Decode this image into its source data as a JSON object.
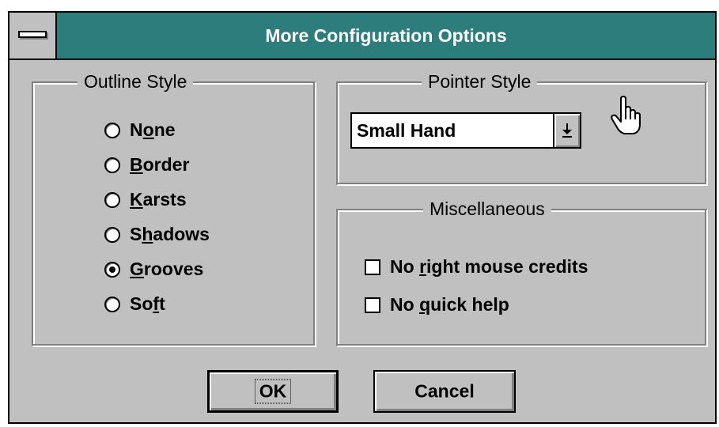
{
  "window": {
    "title": "More Configuration Options"
  },
  "outline_style": {
    "legend": "Outline Style",
    "options": [
      {
        "pre": "N",
        "acc": "o",
        "post": "ne",
        "selected": false
      },
      {
        "pre": "",
        "acc": "B",
        "post": "order",
        "selected": false
      },
      {
        "pre": "",
        "acc": "K",
        "post": "arsts",
        "selected": false
      },
      {
        "pre": "S",
        "acc": "h",
        "post": "adows",
        "selected": false
      },
      {
        "pre": "",
        "acc": "G",
        "post": "rooves",
        "selected": true
      },
      {
        "pre": "So",
        "acc": "f",
        "post": "t",
        "selected": false
      }
    ]
  },
  "pointer_style": {
    "legend": "Pointer Style",
    "selected_value": "Small Hand"
  },
  "miscellaneous": {
    "legend": "Miscellaneous",
    "options": [
      {
        "pre": "No ",
        "acc": "r",
        "post": "ight mouse credits",
        "checked": false
      },
      {
        "pre": "No ",
        "acc": "q",
        "post": "uick help",
        "checked": false
      }
    ]
  },
  "buttons": {
    "ok": "OK",
    "cancel": "Cancel"
  },
  "colors": {
    "titlebar": "#2e7d7d",
    "face": "#c0c0c0"
  }
}
